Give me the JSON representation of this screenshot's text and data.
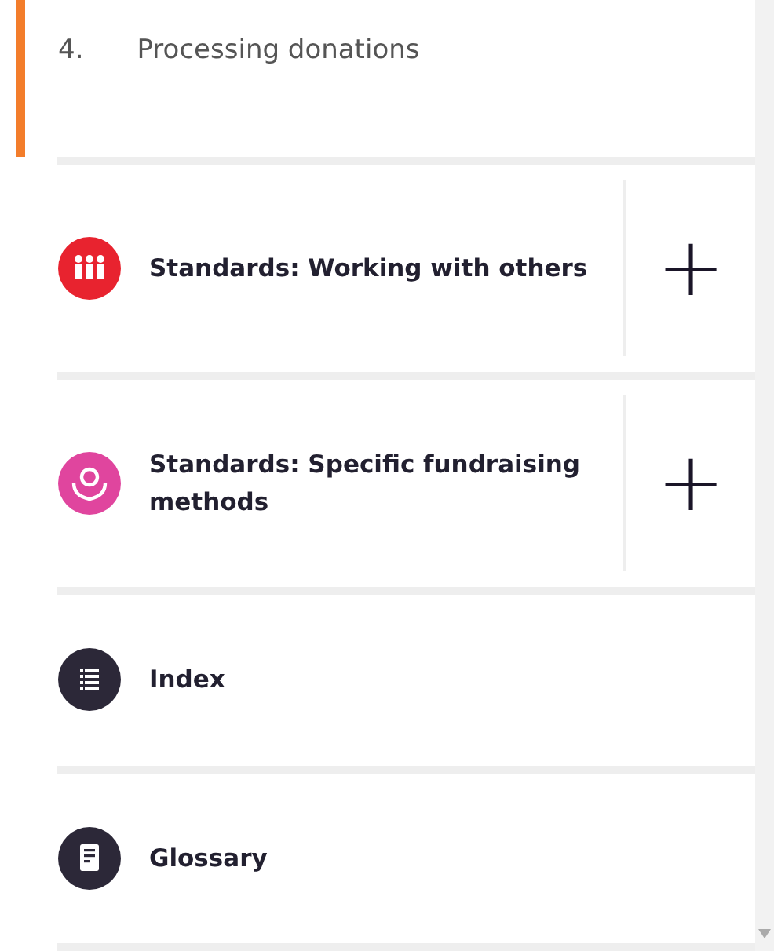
{
  "current_chapter": {
    "number": "4.",
    "title": "Processing donations",
    "selected": true
  },
  "sections": [
    {
      "kind": "expandable",
      "title": "Standards: Working with others",
      "color": "#e8232f",
      "expand_label": "+"
    },
    {
      "kind": "expandable",
      "title": "Standards: Specific fundraising methods",
      "color": "#e0459e",
      "expand_label": "+"
    },
    {
      "kind": "link",
      "title": "Index",
      "color": "#2c2838"
    },
    {
      "kind": "link",
      "title": "Glossary",
      "color": "#2c2838"
    }
  ]
}
